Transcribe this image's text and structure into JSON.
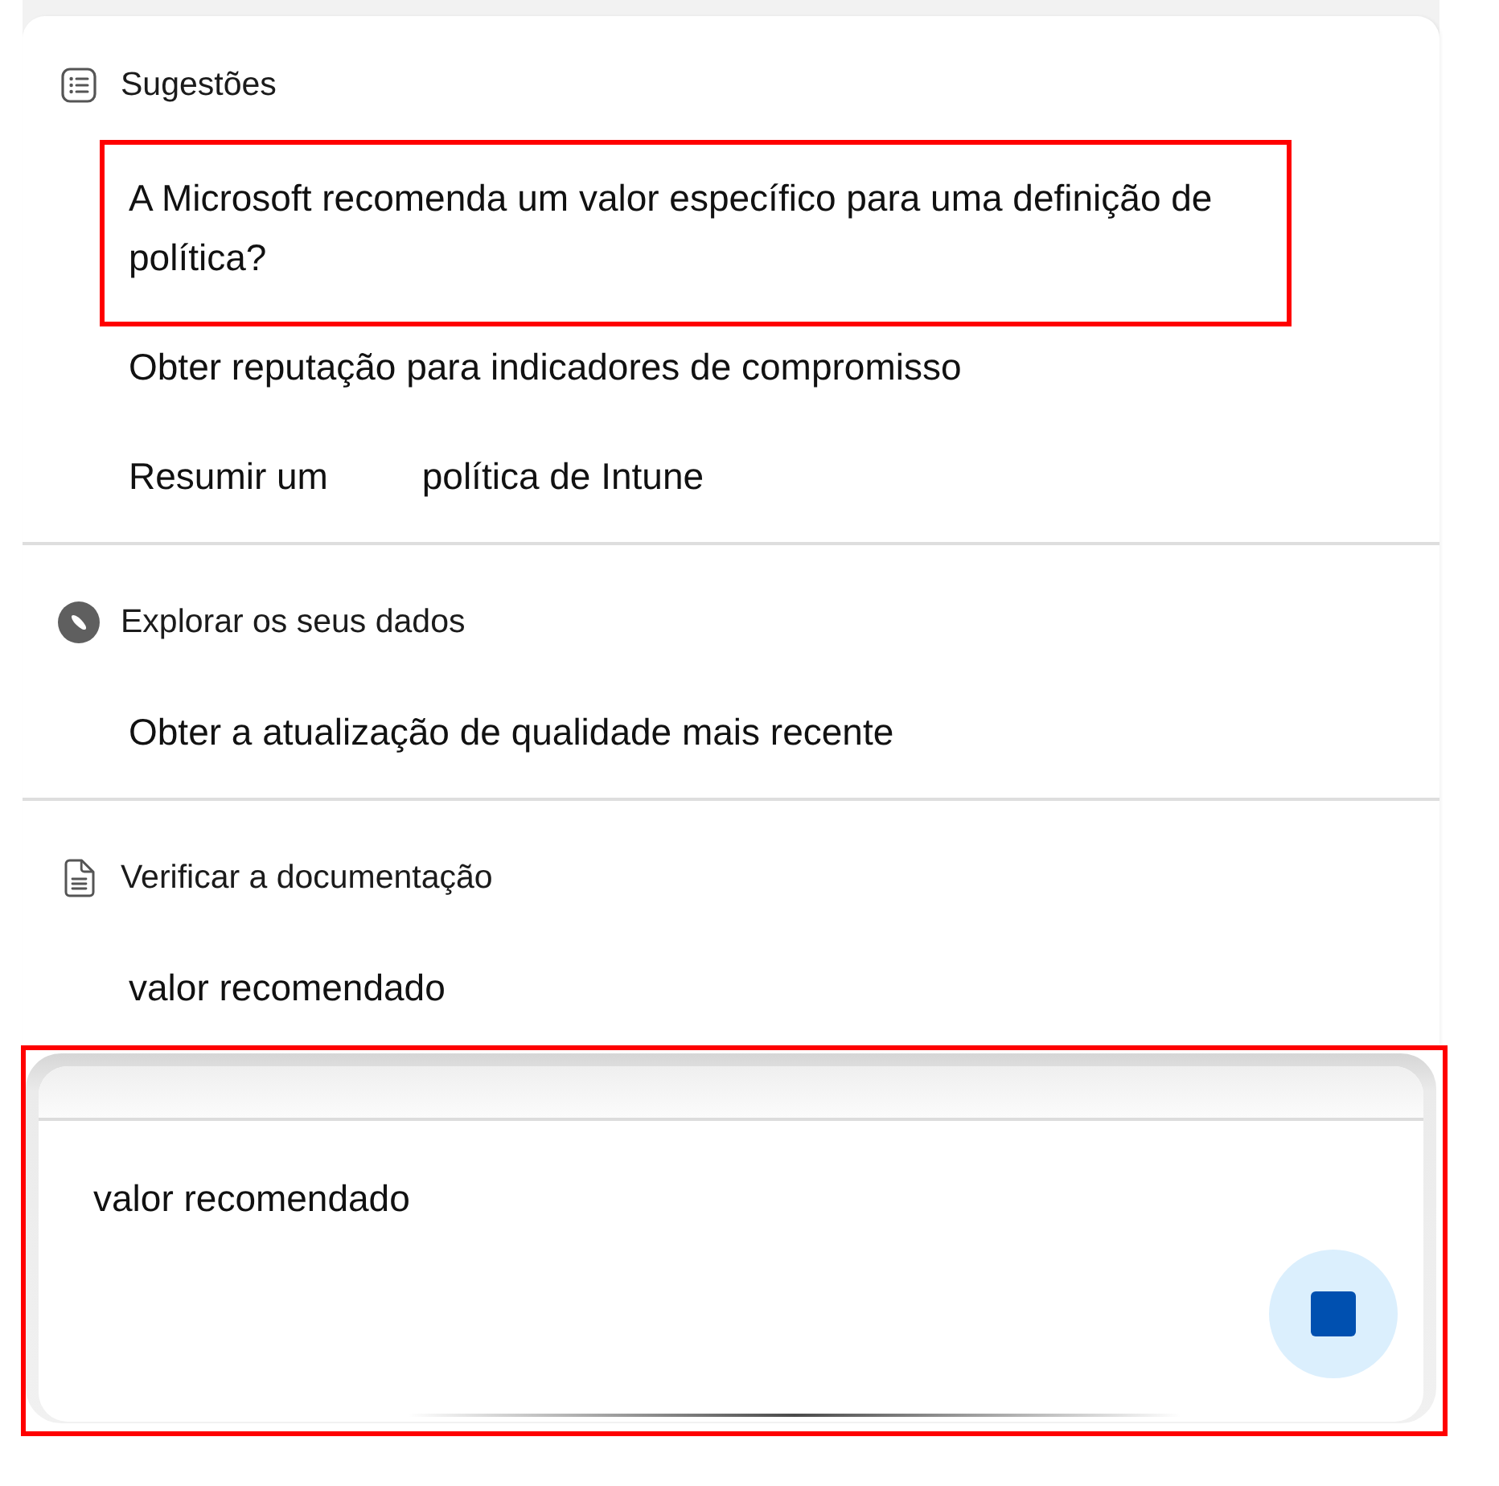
{
  "suggestion_groups": [
    {
      "kind": "list",
      "title": "Sugestões",
      "items": [
        {
          "parts": [
            "A Microsoft recomenda um valor específico para uma definição de política?"
          ],
          "highlighted": true
        },
        {
          "parts": [
            "Obter reputação para indicadores de compromisso"
          ],
          "highlighted": false
        },
        {
          "parts": [
            "Resumir um",
            "política de Intune"
          ],
          "highlighted": false
        }
      ]
    },
    {
      "kind": "compass",
      "title": "Explorar os seus dados",
      "items": [
        {
          "parts": [
            "Obter a atualização de qualidade mais recente"
          ],
          "highlighted": false
        }
      ]
    },
    {
      "kind": "document",
      "title": "Verificar a documentação",
      "items": [
        {
          "parts": [
            "valor recomendado"
          ],
          "highlighted": false
        }
      ]
    }
  ],
  "composer": {
    "value": "valor recomendado",
    "highlighted": true,
    "generating": true
  }
}
